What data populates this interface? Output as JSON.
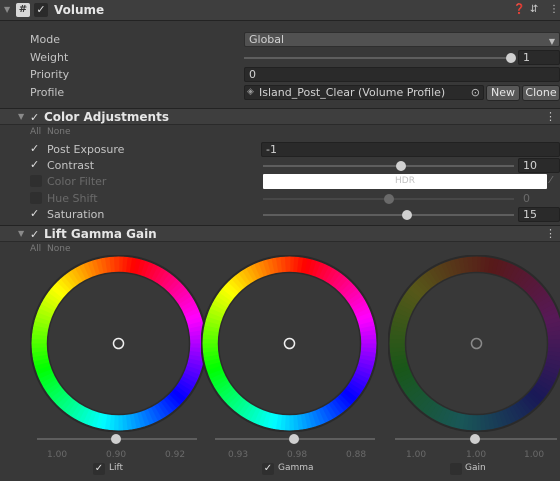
{
  "volume": {
    "title": "Volume",
    "icon_glyph": "#",
    "checked_glyph": "✓",
    "header_icons": [
      "help-icon",
      "settings-icon",
      "menu-icon"
    ],
    "mode": {
      "label": "Mode",
      "value": "Global"
    },
    "weight": {
      "label": "Weight",
      "value": "1",
      "level": 1.0
    },
    "priority": {
      "label": "Priority",
      "value": "0"
    },
    "profile": {
      "label": "Profile",
      "value": "Island_Post_Clear (Volume Profile)",
      "new_label": "New",
      "clone_label": "Clone"
    }
  },
  "color_adjustments": {
    "title": "Color Adjustments",
    "all_label": "All",
    "none_label": "None",
    "rows": [
      {
        "label": "Post Exposure",
        "value": "-1",
        "enabled": true
      },
      {
        "label": "Contrast",
        "value": "10",
        "enabled": true
      },
      {
        "label": "Color Filter",
        "value": "HDR",
        "enabled": false
      },
      {
        "label": "Hue Shift",
        "value": "0",
        "enabled": false
      },
      {
        "label": "Saturation",
        "value": "15",
        "enabled": true
      }
    ]
  },
  "lift_gamma_gain": {
    "title": "Lift Gamma Gain",
    "all_label": "All",
    "none_label": "None",
    "wheels": [
      {
        "label": "Lift",
        "r": "1.00",
        "g": "0.90",
        "b": "0.92",
        "checked": true,
        "active": true
      },
      {
        "label": "Gamma",
        "r": "0.93",
        "g": "0.98",
        "b": "0.88",
        "checked": true,
        "active": true
      },
      {
        "label": "Gain",
        "r": "1.00",
        "g": "1.00",
        "b": "1.00",
        "checked": false,
        "active": false
      }
    ]
  },
  "colors": {
    "accent": "#383838",
    "panel": "#3e3e3e",
    "field": "#2a2a2a"
  }
}
